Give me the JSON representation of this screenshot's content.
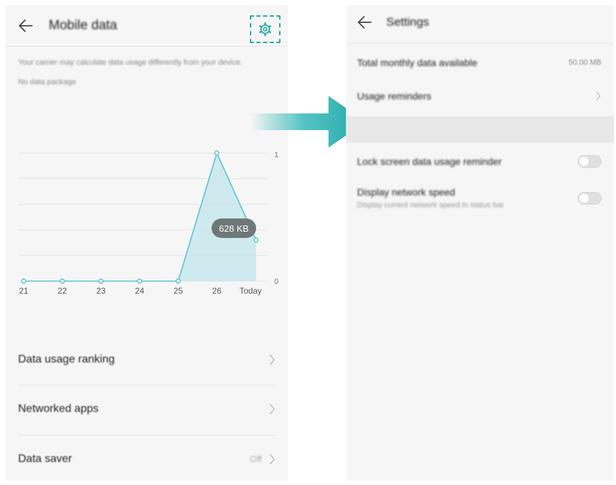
{
  "left_screen": {
    "header": {
      "title": "Mobile data"
    },
    "carrier_note": "Your carrier may calculate data usage differently from your device.",
    "package_note": "No data package",
    "list": [
      {
        "label": "Data usage ranking",
        "value": ""
      },
      {
        "label": "Networked apps",
        "value": ""
      },
      {
        "label": "Data saver",
        "value": "Off"
      }
    ]
  },
  "right_screen": {
    "header": {
      "title": "Settings"
    },
    "total_monthly": {
      "label": "Total monthly data available",
      "value": "50.00 MB"
    },
    "usage_reminders": {
      "label": "Usage reminders"
    },
    "lock_screen_reminder": {
      "label": "Lock screen data usage reminder",
      "enabled": false
    },
    "network_speed": {
      "label": "Display network speed",
      "sublabel": "Display current network speed in status bar",
      "enabled": false
    }
  },
  "chart_data": {
    "type": "area",
    "categories": [
      "21",
      "22",
      "23",
      "24",
      "25",
      "26",
      "Today"
    ],
    "values": [
      0,
      0,
      0,
      0,
      0,
      1,
      0.32
    ],
    "ylim": [
      0,
      1
    ],
    "y_ticks": [
      "1",
      "0"
    ],
    "tooltip": "628 KB",
    "grid": true
  },
  "colors": {
    "accent": "#22a7a7",
    "line": "#57c3d3",
    "fill": "#bfe5ec",
    "panel_bg": "#f6f6f6"
  },
  "icons": {
    "back": "arrow-left-icon",
    "settings": "gear-icon",
    "chevron": "chevron-right-icon",
    "transition": "arrow-right-icon"
  }
}
